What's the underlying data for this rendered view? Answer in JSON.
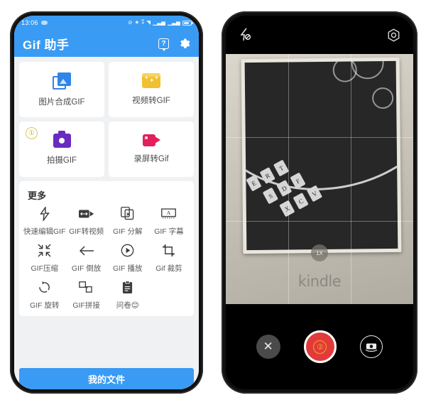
{
  "left_phone": {
    "status_bar": {
      "time": "13:06",
      "icons": [
        "cloud-pill",
        "mute-icon",
        "bluetooth-icon",
        "hd-icon",
        "wifi-icon",
        "signal-icon",
        "signal-icon-2",
        "battery-icon"
      ]
    },
    "app_bar": {
      "title": "Gif 助手",
      "help_label": "?",
      "help_name": "help-icon",
      "settings_name": "gear-icon"
    },
    "main_cards": [
      {
        "label": "图片合成GIF",
        "icon": "photos-icon",
        "color": "#2f86e8",
        "badge": ""
      },
      {
        "label": "视频转GIF",
        "icon": "clapperboard-icon",
        "color": "#f0c02e",
        "badge": ""
      },
      {
        "label": "拍摄GIF",
        "icon": "camera-icon",
        "color": "#6a2bbf",
        "badge": "①"
      },
      {
        "label": "录屏转Gif",
        "icon": "video-camera-icon",
        "color": "#e31f5c",
        "badge": ""
      }
    ],
    "more": {
      "title": "更多",
      "items": [
        {
          "label": "快速编辑GIF",
          "glyph": "⚡",
          "icon": "lightning-icon"
        },
        {
          "label": "GIF转视频",
          "glyph": "🎥",
          "icon": "video-convert-icon"
        },
        {
          "label": "GIF 分解",
          "glyph": "🗂",
          "icon": "split-frames-icon"
        },
        {
          "label": "GIF 字幕",
          "glyph": "🅰",
          "icon": "subtitle-icon"
        },
        {
          "label": "GIF压缩",
          "glyph": "⤡",
          "icon": "compress-icon"
        },
        {
          "label": "GIF 倒放",
          "glyph": "←",
          "icon": "reverse-arrow-icon"
        },
        {
          "label": "GIF 播放",
          "glyph": "▶",
          "icon": "play-icon"
        },
        {
          "label": "Gif 裁剪",
          "glyph": "⌗",
          "icon": "crop-icon"
        },
        {
          "label": "GIF 旋转",
          "glyph": "↻",
          "icon": "rotate-icon"
        },
        {
          "label": "GIF拼接",
          "glyph": "⧉",
          "icon": "stitch-icon"
        },
        {
          "label": "问卷😊",
          "glyph": "📋",
          "icon": "clipboard-icon"
        }
      ]
    },
    "bottom_button": {
      "label": "我的文件"
    }
  },
  "right_phone": {
    "top_bar": {
      "flash_name": "flash-off-icon",
      "settings_name": "camera-settings-icon"
    },
    "viewfinder": {
      "device_wordmark": "kindle",
      "zoom_level": "1X",
      "grid_enabled": true,
      "keys": [
        [
          "E",
          "R",
          "T"
        ],
        [
          "S",
          "D",
          "F"
        ],
        [
          "X",
          "C",
          "V"
        ]
      ]
    },
    "controls": {
      "close_label": "✕",
      "close_name": "close-button",
      "shutter_badge": "②",
      "shutter_name": "record-button",
      "flip_name": "switch-camera-button"
    }
  },
  "colors": {
    "accent_blue": "#3a9bf4",
    "record_red": "#e23a3a",
    "badge_gold": "#f0a81e",
    "page_bg": "#f0f1f3"
  }
}
